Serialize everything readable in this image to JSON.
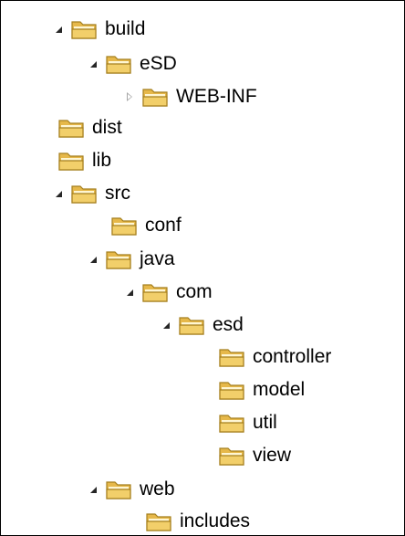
{
  "tree": {
    "items": [
      {
        "label": "build",
        "state": "expanded"
      },
      {
        "label": "eSD",
        "state": "expanded"
      },
      {
        "label": "WEB-INF",
        "state": "collapsed"
      },
      {
        "label": "dist",
        "state": "leaf"
      },
      {
        "label": "lib",
        "state": "leaf"
      },
      {
        "label": "src",
        "state": "expanded"
      },
      {
        "label": "conf",
        "state": "leaf"
      },
      {
        "label": "java",
        "state": "expanded"
      },
      {
        "label": "com",
        "state": "expanded"
      },
      {
        "label": "esd",
        "state": "expanded"
      },
      {
        "label": "controller",
        "state": "leaf"
      },
      {
        "label": "model",
        "state": "leaf"
      },
      {
        "label": "util",
        "state": "leaf"
      },
      {
        "label": "view",
        "state": "leaf"
      },
      {
        "label": "web",
        "state": "expanded"
      },
      {
        "label": "includes",
        "state": "leaf"
      }
    ]
  },
  "colors": {
    "folder_body": "#f2cf6a",
    "folder_back": "#e6b84a",
    "folder_outline": "#a57f1f",
    "folder_inner": "#fff6d2",
    "arrow_expanded": "#262626",
    "arrow_collapsed": "#a8a8a8",
    "frame_border": "#000000"
  }
}
